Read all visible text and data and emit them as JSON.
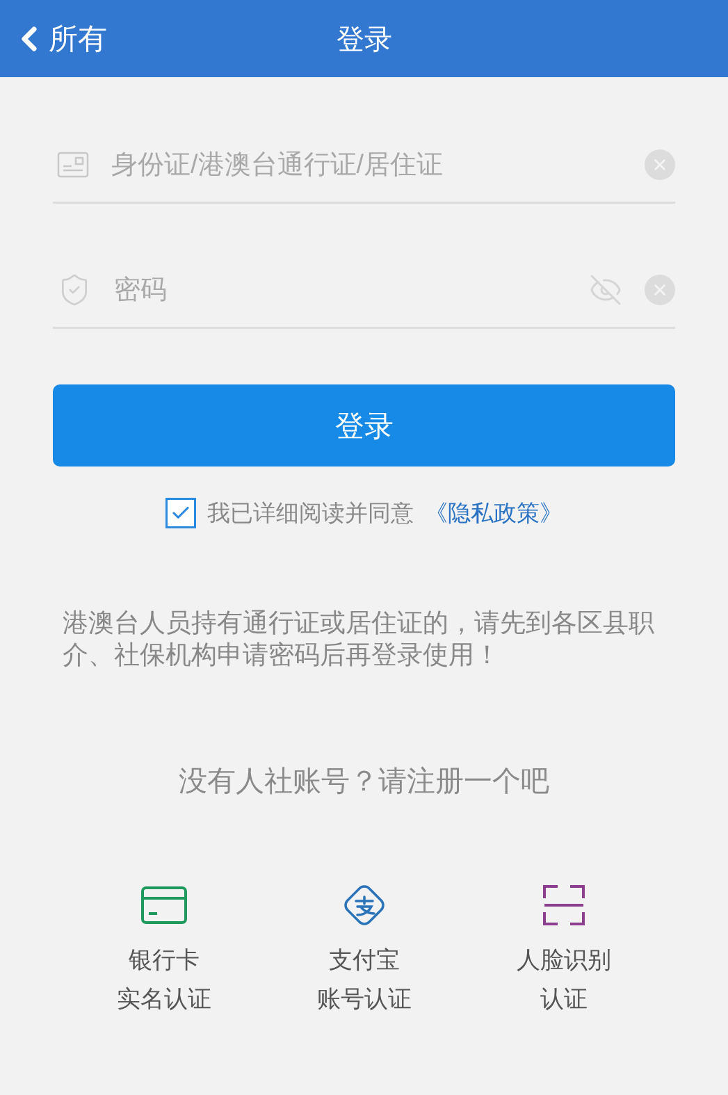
{
  "header": {
    "back_label": "所有",
    "title": "登录"
  },
  "fields": [
    {
      "kind": "account",
      "placeholder": "身份证/港澳台通行证/居住证"
    },
    {
      "kind": "password",
      "placeholder": "密码"
    }
  ],
  "login_button": "登录",
  "agreement": {
    "checked": true,
    "text": "我已详细阅读并同意",
    "link": "《隐私政策》"
  },
  "notice": "港澳台人员持有通行证或居住证的，请先到各区县职介、社保机构申请密码后再登录使用！",
  "register_prompt": "没有人社账号？请注册一个吧",
  "auth_options": [
    {
      "kind": "bank_card",
      "color": "#1f9a5c",
      "lines": [
        "银行卡",
        "实名认证"
      ]
    },
    {
      "kind": "alipay",
      "color": "#2a73b8",
      "lines": [
        "支付宝",
        "账号认证"
      ]
    },
    {
      "kind": "face",
      "color": "#8c3f8e",
      "lines": [
        "人脸识别",
        "认证"
      ]
    }
  ]
}
